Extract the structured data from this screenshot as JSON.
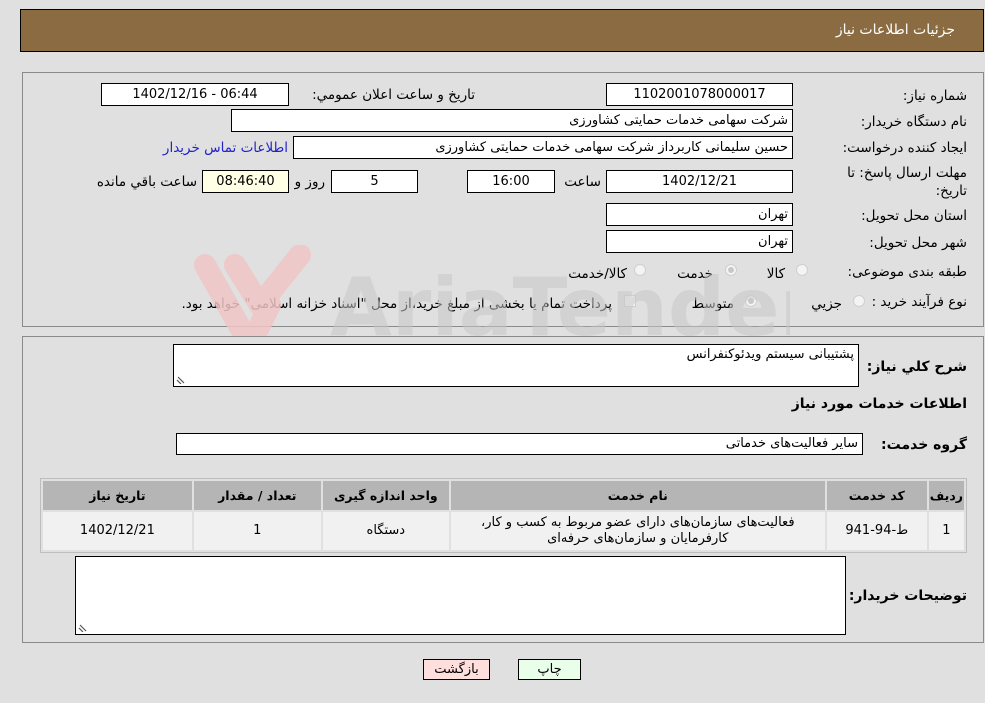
{
  "header": {
    "title": "جزئیات اطلاعات نیاز"
  },
  "form": {
    "need_number_label": "شماره نیاز:",
    "need_number": "1102001078000017",
    "announce_label": "تاریخ و ساعت اعلان عمومي:",
    "announce_value": "1402/12/16 - 06:44",
    "buyer_org_label": "نام دستگاه خریدار:",
    "buyer_org": "شرکت سهامی خدمات حمایتی کشاورزی",
    "creator_label": "ایجاد کننده درخواست:",
    "creator": "حسین سلیمانی کاربرداز شرکت سهامی خدمات حمایتی کشاورزی",
    "contact_link": "اطلاعات تماس خریدار",
    "deadline_label": "مهلت ارسال پاسخ: تا تاریخ:",
    "deadline_date": "1402/12/21",
    "time_label": "ساعت",
    "deadline_time": "16:00",
    "days_value": "5",
    "days_label": "روز و",
    "remaining_time": "08:46:40",
    "remaining_label": "ساعت باقي مانده",
    "province_label": "استان محل تحویل:",
    "province": "تهران",
    "city_label": "شهر محل تحویل:",
    "city": "تهران",
    "category_label": "طبقه بندی موضوعی:",
    "category_options": [
      "کالا",
      "خدمت",
      "کالا/خدمت"
    ],
    "category_selected": "خدمت",
    "process_label": "نوع فرآیند خرید :",
    "process_options": [
      "جزیي",
      "متوسط"
    ],
    "process_selected": "متوسط",
    "treasury_note": "پرداخت تمام یا بخشی از مبلغ خرید،از محل \"اسناد خزانه اسلامی\" خواهد بود."
  },
  "details": {
    "summary_label": "شرح كلي نياز:",
    "summary_value": "پشتیبانی سیستم ویدئوکنفرانس",
    "services_heading": "اطلاعات خدمات مورد نیاز",
    "service_group_label": "گروه خدمت:",
    "service_group": "سایر فعالیت‌های خدماتی",
    "table": {
      "headers": [
        "ردیف",
        "کد خدمت",
        "نام خدمت",
        "واحد اندازه گیری",
        "تعداد / مقدار",
        "تاریخ نیاز"
      ],
      "rows": [
        [
          "1",
          "ط-94-941",
          "فعالیت‌های سازمان‌های دارای عضو مربوط به کسب و کار، کارفرمایان و سازمان‌های حرفه‌ای",
          "دستگاه",
          "1",
          "1402/12/21"
        ]
      ]
    },
    "buyer_notes_label": "توضیحات خریدار:",
    "buyer_notes": ""
  },
  "buttons": {
    "print": "چاپ",
    "back": "بازگشت"
  },
  "watermark": "AriaTender.neT",
  "colors": {
    "header_bg": "#8b6c42",
    "print_bg": "#eaffea",
    "back_bg": "#ffdede",
    "link": "#2222cc"
  }
}
